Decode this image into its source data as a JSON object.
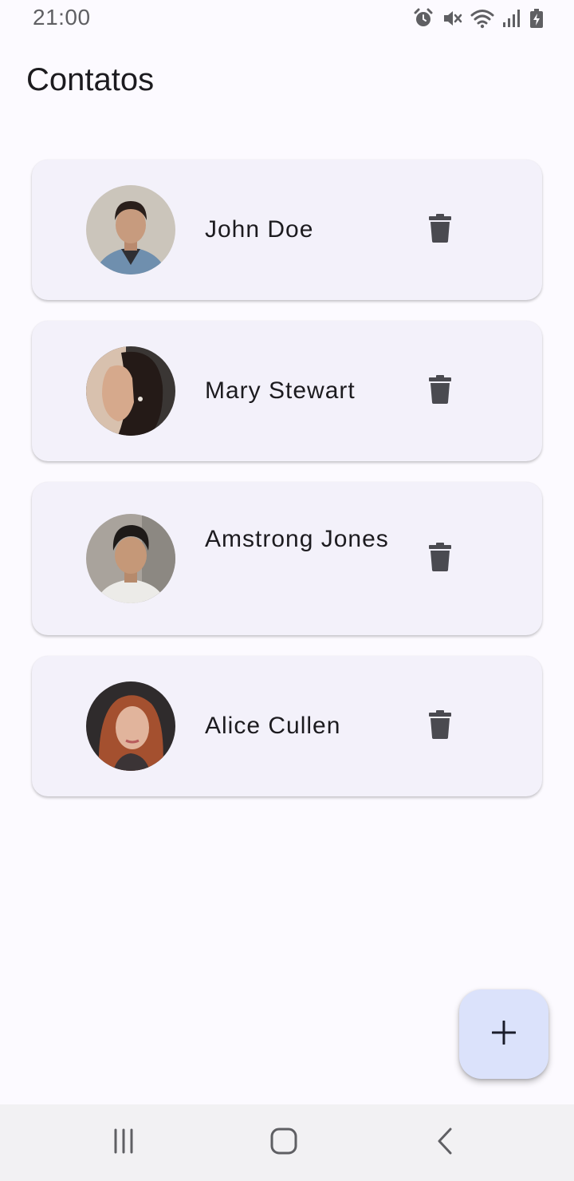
{
  "status_bar": {
    "time": "21:00",
    "icons": [
      "alarm-icon",
      "mute-icon",
      "wifi-icon",
      "signal-icon",
      "battery-charging-icon"
    ]
  },
  "app_bar": {
    "title": "Contatos"
  },
  "contacts": [
    {
      "name": "John Doe",
      "avatar": "avatar-photo",
      "delete_icon": "trash-icon"
    },
    {
      "name": "Mary Stewart",
      "avatar": "avatar-photo",
      "delete_icon": "trash-icon"
    },
    {
      "name": "Amstrong Jones",
      "avatar": "avatar-photo",
      "delete_icon": "trash-icon"
    },
    {
      "name": "Alice Cullen",
      "avatar": "avatar-photo",
      "delete_icon": "trash-icon"
    }
  ],
  "fab": {
    "icon": "plus-icon"
  },
  "nav_bar": {
    "buttons": [
      "recents-icon",
      "home-icon",
      "back-icon"
    ]
  },
  "colors": {
    "background": "#fcfaff",
    "card": "#f3f1fa",
    "fab": "#dbe2fb",
    "icon": "#4a4a50",
    "nav_bar": "#f2f1f3"
  }
}
